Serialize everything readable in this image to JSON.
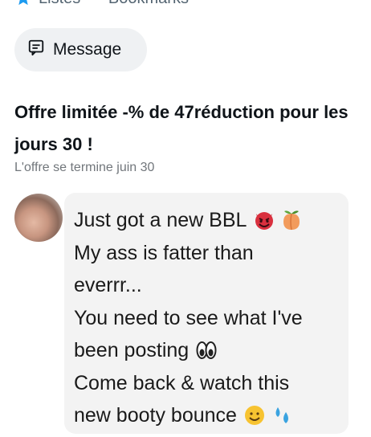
{
  "top": {
    "lists_label": "Listes",
    "bookmarks_label": "Bookmarks"
  },
  "message_button": {
    "label": "Message"
  },
  "offer": {
    "title": "Offre limitée -% de 47réduction pour les jours 30 !",
    "subtitle": "L'offre se termine juin 30"
  },
  "chat": {
    "lines": [
      "Just got a new BBL",
      "My ass is fatter than",
      "everrr...",
      "You need to see what I've",
      "been posting",
      "Come back & watch this",
      "new booty bounce"
    ],
    "emojis": {
      "line1": [
        "smiling-devil-icon",
        "peach-icon"
      ],
      "line5": [
        "eyes-icon"
      ],
      "line7": [
        "grin-icon",
        "sweat-droplets-icon"
      ]
    }
  },
  "colors": {
    "accent_blue": "#1d9bf0",
    "button_bg": "#eff1f3",
    "bubble_bg": "#f3f3f3",
    "muted_text": "#71767b"
  }
}
